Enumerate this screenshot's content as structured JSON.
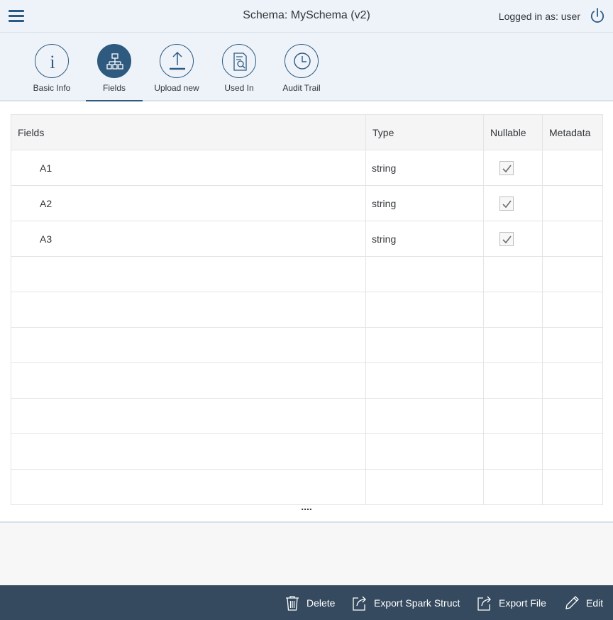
{
  "header": {
    "title": "Schema: MySchema (v2)",
    "user_label": "Logged in as: user"
  },
  "tabs": [
    {
      "label": "Basic Info",
      "icon": "info-icon",
      "selected": false
    },
    {
      "label": "Fields",
      "icon": "hierarchy-icon",
      "selected": true
    },
    {
      "label": "Upload new",
      "icon": "upload-icon",
      "selected": false
    },
    {
      "label": "Used In",
      "icon": "document-search-icon",
      "selected": false
    },
    {
      "label": "Audit Trail",
      "icon": "clock-icon",
      "selected": false
    }
  ],
  "table": {
    "columns": [
      "Fields",
      "Type",
      "Nullable",
      "Metadata"
    ],
    "rows": [
      {
        "field": "A1",
        "type": "string",
        "nullable": true,
        "metadata": ""
      },
      {
        "field": "A2",
        "type": "string",
        "nullable": true,
        "metadata": ""
      },
      {
        "field": "A3",
        "type": "string",
        "nullable": true,
        "metadata": ""
      }
    ],
    "more_indicator": "...."
  },
  "footer": {
    "delete_label": "Delete",
    "export_spark_label": "Export Spark Struct",
    "export_file_label": "Export File",
    "edit_label": "Edit"
  },
  "colors": {
    "accent": "#2f5a80",
    "header_bg": "#eef3f9",
    "footer_bg": "#354a5f"
  }
}
